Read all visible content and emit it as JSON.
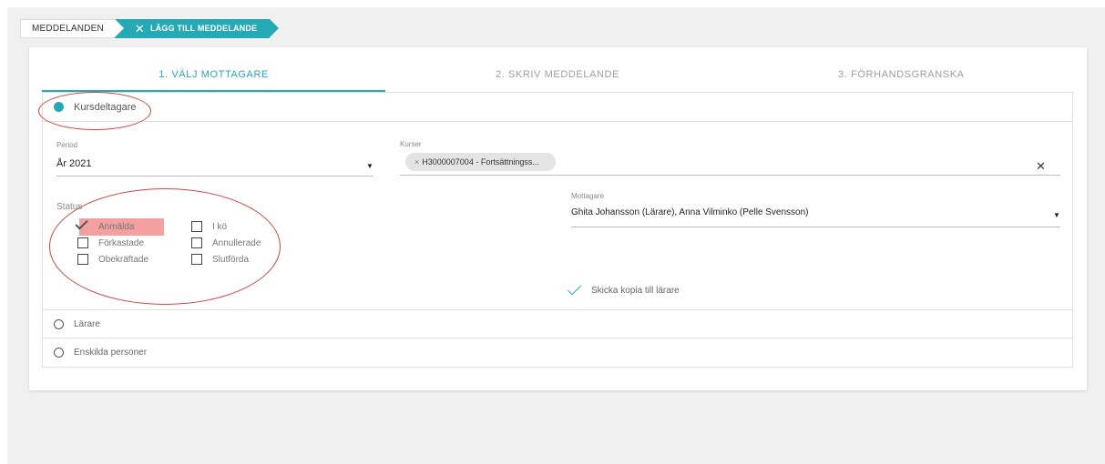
{
  "breadcrumb": {
    "home_label": "MEDDELANDEN",
    "active_label": "LÄGG TILL MEDDELANDE"
  },
  "tabs": [
    {
      "label": "1. VÄLJ MOTTAGARE",
      "active": true
    },
    {
      "label": "2. SKRIV MEDDELANDE",
      "active": false
    },
    {
      "label": "3. FÖRHANDSGRANSKA",
      "active": false
    }
  ],
  "recipient_types": {
    "course_participants": {
      "label": "Kursdeltagare",
      "selected": true
    },
    "teachers": {
      "label": "Lärare",
      "selected": false
    },
    "individuals": {
      "label": "Enskilda personer",
      "selected": false
    }
  },
  "period": {
    "label": "Period",
    "value": "År 2021"
  },
  "courses": {
    "label": "Kurser",
    "chip": "H3000007004 - Fortsättningss..."
  },
  "status": {
    "label": "Status",
    "options": [
      {
        "label": "Anmälda",
        "checked": true
      },
      {
        "label": "Förkastade",
        "checked": false
      },
      {
        "label": "Obekräftade",
        "checked": false
      },
      {
        "label": "I kö",
        "checked": false
      },
      {
        "label": "Annullerade",
        "checked": false
      },
      {
        "label": "Slutförda",
        "checked": false
      }
    ]
  },
  "recipients": {
    "label": "Mottagare",
    "value": "Ghita Johansson (Lärare), Anna Vilminko (Pelle Svensson)"
  },
  "copy_to_teacher": {
    "label": "Skicka kopia till lärare",
    "checked": true
  },
  "colors": {
    "accent": "#25a9b5",
    "annotation": "#d64541",
    "highlight": "#f08080"
  }
}
